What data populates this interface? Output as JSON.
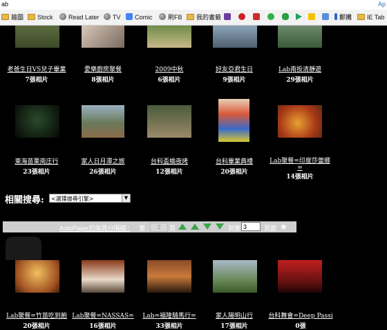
{
  "browser": {
    "url_text": "ab",
    "ap_text": "Ap"
  },
  "bookmarks": [
    {
      "label": "牆圖",
      "icon": "folder-icon"
    },
    {
      "label": "Stock",
      "icon": "folder-icon"
    },
    {
      "label": "Read Later",
      "icon": "globe-icon"
    },
    {
      "label": "TV",
      "icon": "globe-icon"
    },
    {
      "label": "Comic",
      "icon": "google-icon"
    },
    {
      "label": "刷FB",
      "icon": "globe-icon"
    },
    {
      "label": "我的書籤",
      "icon": "folder-icon"
    },
    {
      "label": "",
      "icon": "purple-app-icon"
    },
    {
      "label": "",
      "icon": "pinterest-icon"
    },
    {
      "label": "",
      "icon": "red-app-icon"
    },
    {
      "label": "",
      "icon": "green-chat-icon"
    },
    {
      "label": "",
      "icon": "clover-icon"
    },
    {
      "label": "",
      "icon": "play-icon"
    },
    {
      "label": "",
      "icon": "yellow-app-icon"
    },
    {
      "label": "",
      "icon": "image-icon"
    },
    {
      "label": "郵攤",
      "icon": "blue-app-icon"
    },
    {
      "label": "IE Tab",
      "icon": "folder-icon"
    }
  ],
  "albums_row1": [
    {
      "title": "老爸生日VS兒子畢業",
      "count": "7張相片"
    },
    {
      "title": "愛樂廚房聚餐",
      "count": "8張相片"
    },
    {
      "title": "2009中秋",
      "count": "6張相片"
    },
    {
      "title": "好友亞君生日",
      "count": "9張相片"
    },
    {
      "title": "Lab南投清靜遊",
      "count": "29張相片"
    }
  ],
  "albums_row2": [
    {
      "title": "東海苗栗南庄行",
      "count": "23張相片"
    },
    {
      "title": "家人日月潭之旅",
      "count": "26張相片"
    },
    {
      "title": "台科盃橋夜烤",
      "count": "12張相片"
    },
    {
      "title": "台科畢業典禮",
      "count": "20張相片"
    },
    {
      "title_line1": "Lab聚餐=印度莎蕾娜",
      "title_line2": "=",
      "count": "14張相片"
    }
  ],
  "albums_row3": [
    {
      "title": "Lab聚餐=竹苗吃到飽",
      "count": "20張相片"
    },
    {
      "title": "Lab聚餐=NASSAS=",
      "count": "16張相片"
    },
    {
      "title": "Lab=福隆騎馬行=",
      "count": "33張相片"
    },
    {
      "title": "家人陽明山行",
      "count": "17張相片"
    },
    {
      "title": "台科舞會=Deep Passi",
      "count": "0張"
    }
  ],
  "search": {
    "label": "相關搜尋:",
    "select_value": "<選擇搜尋引擎>"
  },
  "autopager": {
    "text": "AutoPager的換頁分隔線 :",
    "page_prefix": "第",
    "page_value": "2",
    "page_suffix": "頁",
    "goto_prefix": "到第",
    "goto_value": "3",
    "goto_suffix": "頁面"
  },
  "colors": {
    "page_bg": "#000000",
    "arrow_green": "#3aa64a",
    "autopager_bg": "#cfcfcf"
  }
}
